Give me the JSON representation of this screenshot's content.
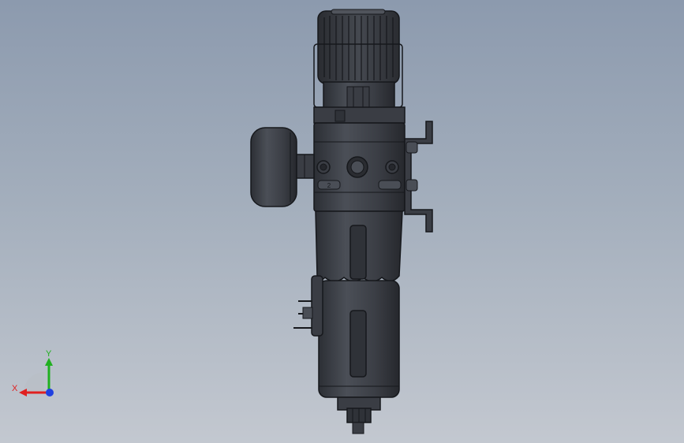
{
  "view": {
    "background_top": "#8c9aae",
    "background_bottom": "#c3c8d0",
    "model_color": "#3f4249",
    "model_edge": "#16181c"
  },
  "part": {
    "port_label": "2"
  },
  "triad": {
    "x_label": "X",
    "y_label": "Y",
    "x_color": "#e02020",
    "y_color": "#20b020",
    "z_color": "#2040e0"
  }
}
